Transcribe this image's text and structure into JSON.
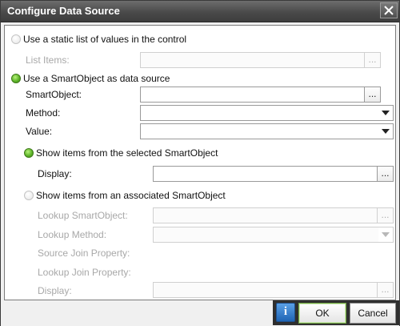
{
  "window": {
    "title": "Configure Data Source"
  },
  "static_option": {
    "label": "Use a static list of values in the control",
    "selected": false
  },
  "list_items": {
    "label": "List Items:",
    "value": "",
    "browse": "..."
  },
  "smartobject_option": {
    "label": "Use a SmartObject as data source",
    "selected": true
  },
  "smartobject": {
    "label": "SmartObject:",
    "value": "",
    "browse": "..."
  },
  "method": {
    "label": "Method:",
    "value": ""
  },
  "value_field": {
    "label": "Value:",
    "value": ""
  },
  "selected_so_option": {
    "label": "Show items from the selected SmartObject",
    "selected": true
  },
  "display": {
    "label": "Display:",
    "value": "",
    "browse": "..."
  },
  "associated_so_option": {
    "label": "Show items from an associated SmartObject",
    "selected": false
  },
  "lookup_smartobject": {
    "label": "Lookup SmartObject:",
    "value": "",
    "browse": "..."
  },
  "lookup_method": {
    "label": "Lookup Method:",
    "value": ""
  },
  "source_join": {
    "label": "Source Join Property:"
  },
  "lookup_join": {
    "label": "Lookup Join Property:"
  },
  "lookup_display": {
    "label": "Display:",
    "value": "",
    "browse": "..."
  },
  "buttons": {
    "info": "i",
    "ok": "OK",
    "cancel": "Cancel"
  }
}
